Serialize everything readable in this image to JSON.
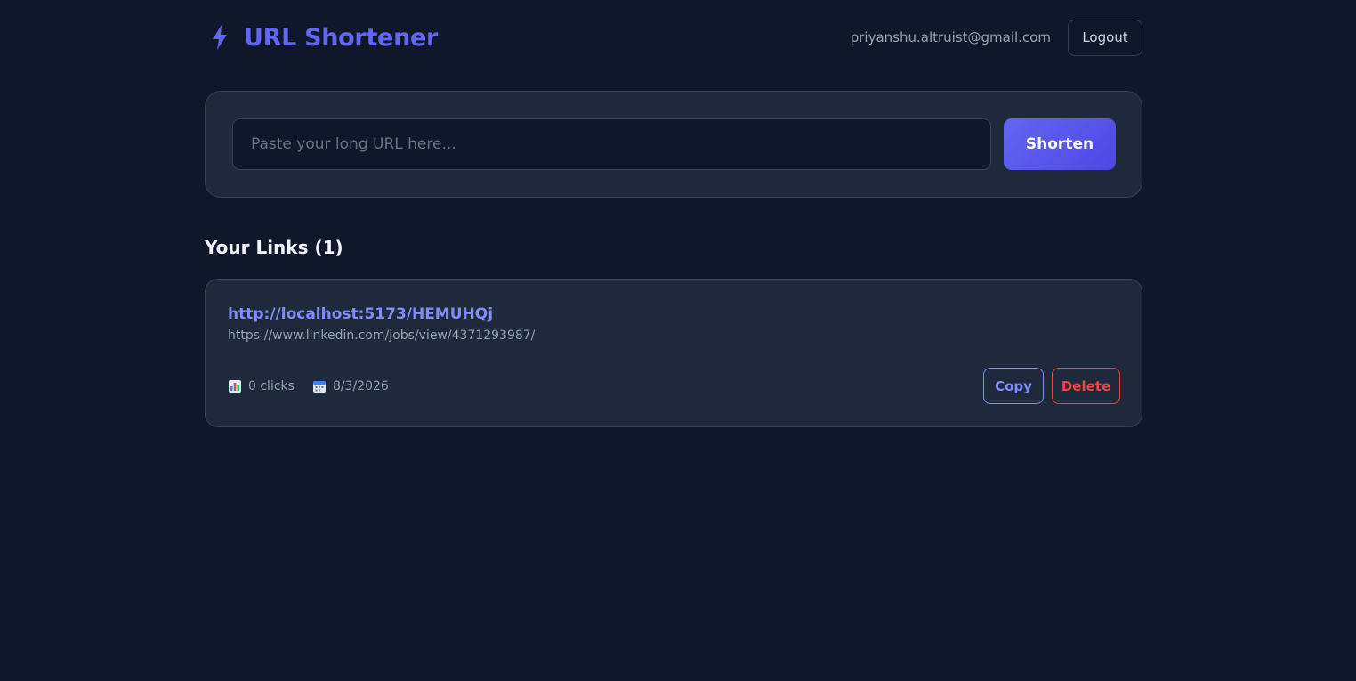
{
  "header": {
    "title": "URL Shortener",
    "brand_icon": "lightning-bolt-icon",
    "user_email": "priyanshu.altruist@gmail.com",
    "logout_label": "Logout"
  },
  "shortener": {
    "input_value": "",
    "input_placeholder": "Paste your long URL here...",
    "submit_label": "Shorten"
  },
  "links": {
    "heading": "Your Links (1)",
    "items": [
      {
        "short_url": "http://localhost:5173/HEMUHQj",
        "original_url": "https://www.linkedin.com/jobs/view/4371293987/",
        "clicks_icon": "bar-chart-icon",
        "clicks": "0 clicks",
        "date_icon": "calendar-icon",
        "date": "8/3/2026",
        "copy_label": "Copy",
        "delete_label": "Delete"
      }
    ]
  },
  "colors": {
    "background": "#0f172a",
    "card": "#1e293b",
    "accent": "#6366f1",
    "link": "#818cf8",
    "danger": "#ef4444"
  }
}
